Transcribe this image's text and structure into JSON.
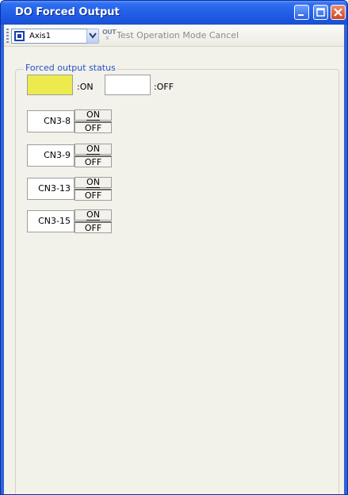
{
  "window": {
    "title": "DO Forced Output"
  },
  "toolbar": {
    "axis_selected": "Axis1",
    "out_icon_text": "OUT",
    "out_icon_cross": "x",
    "cancel_label": "Test Operation Mode Cancel"
  },
  "status": {
    "group_label": "Forced output status",
    "legend_on": ":ON",
    "legend_off": ":OFF",
    "colors": {
      "on": "#ecea4c",
      "off": "#ffffff"
    }
  },
  "signals": [
    {
      "label": "CN3-8",
      "on": "ON",
      "off": "OFF"
    },
    {
      "label": "CN3-9",
      "on": "ON",
      "off": "OFF"
    },
    {
      "label": "CN3-13",
      "on": "ON",
      "off": "OFF"
    },
    {
      "label": "CN3-15",
      "on": "ON",
      "off": "OFF"
    }
  ],
  "icons": [
    "minimize-icon",
    "maximize-icon",
    "close-icon",
    "toolbar-grip-icon",
    "axis-icon",
    "chevron-down-icon",
    "out-icon"
  ]
}
